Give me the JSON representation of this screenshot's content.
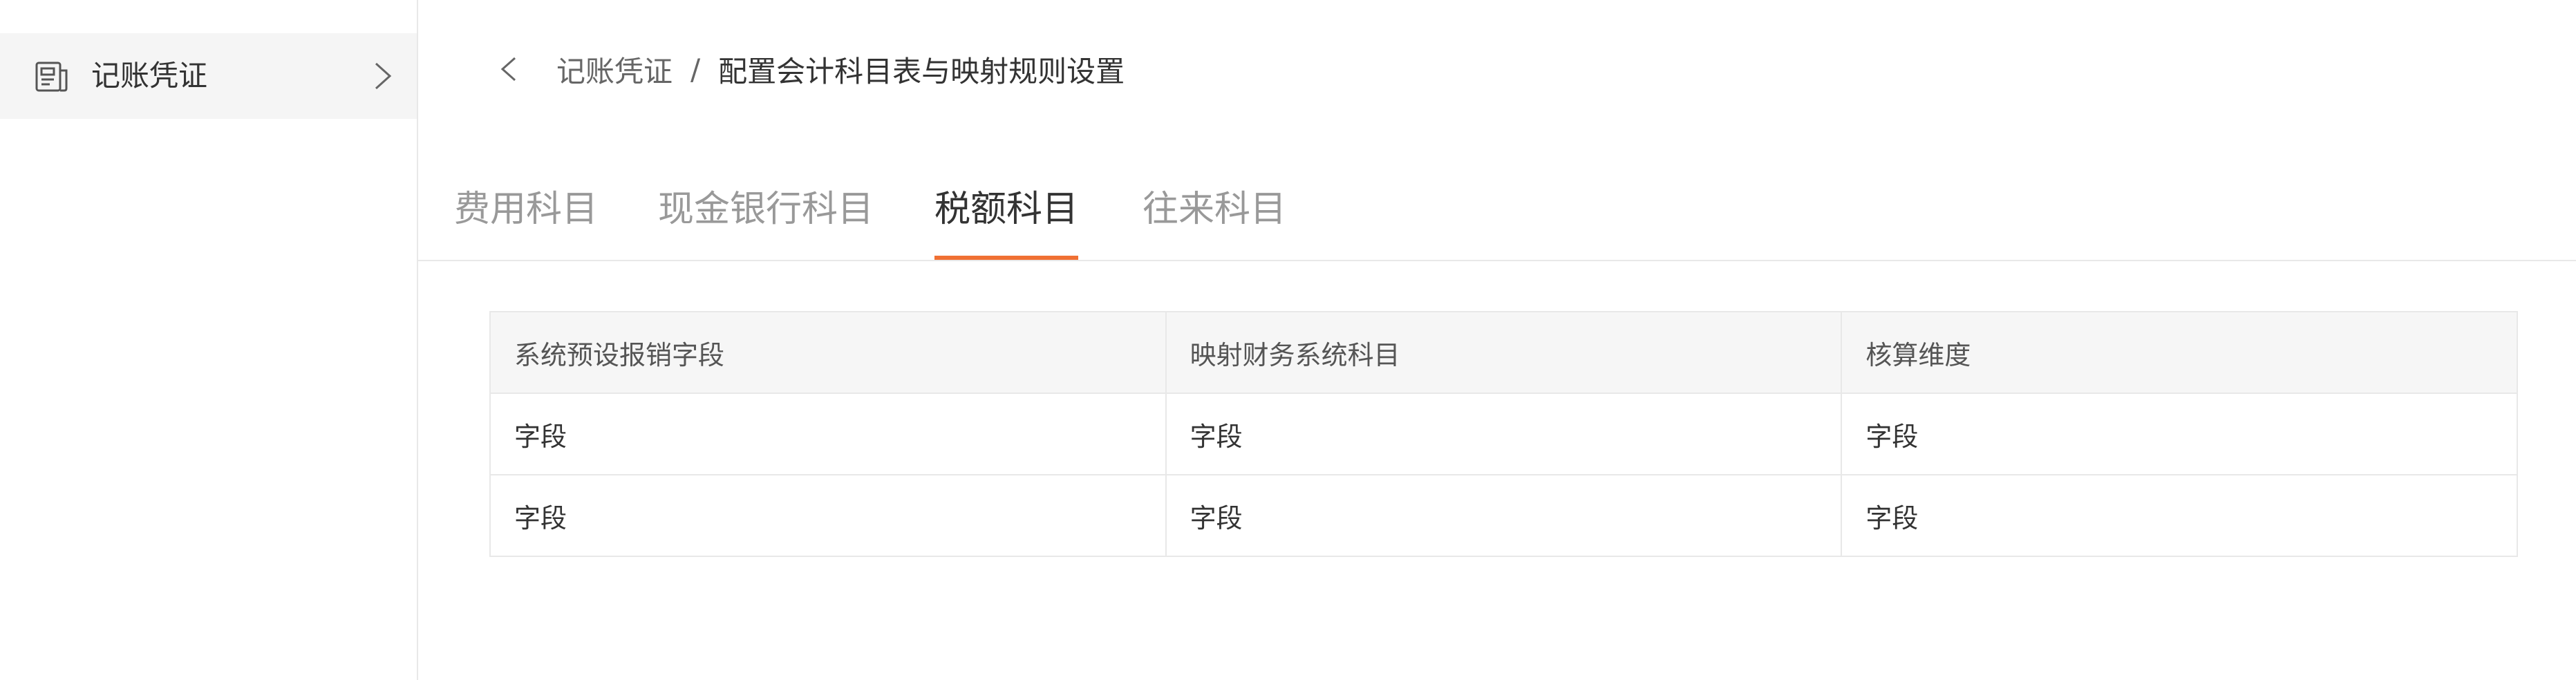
{
  "sidebar": {
    "items": [
      {
        "label": "记账凭证",
        "icon": "document-icon",
        "trailing_icon": "chevron-right-icon"
      }
    ]
  },
  "breadcrumb": {
    "back_icon": "chevron-left-icon",
    "parent": "记账凭证",
    "separator": "/",
    "current": "配置会计科目表与映射规则设置"
  },
  "tabs": [
    {
      "label": "费用科目",
      "active": false
    },
    {
      "label": "现金银行科目",
      "active": false
    },
    {
      "label": "税额科目",
      "active": true
    },
    {
      "label": "往来科目",
      "active": false
    }
  ],
  "colors": {
    "accent": "#f07033",
    "sidebar_active_bg": "#f5f5f5",
    "header_bg": "#f6f6f6",
    "border": "#e8e8e8"
  },
  "table": {
    "headers": [
      "系统预设报销字段",
      "映射财务系统科目",
      "核算维度"
    ],
    "rows": [
      [
        "字段",
        "字段",
        "字段"
      ],
      [
        "字段",
        "字段",
        "字段"
      ]
    ]
  }
}
